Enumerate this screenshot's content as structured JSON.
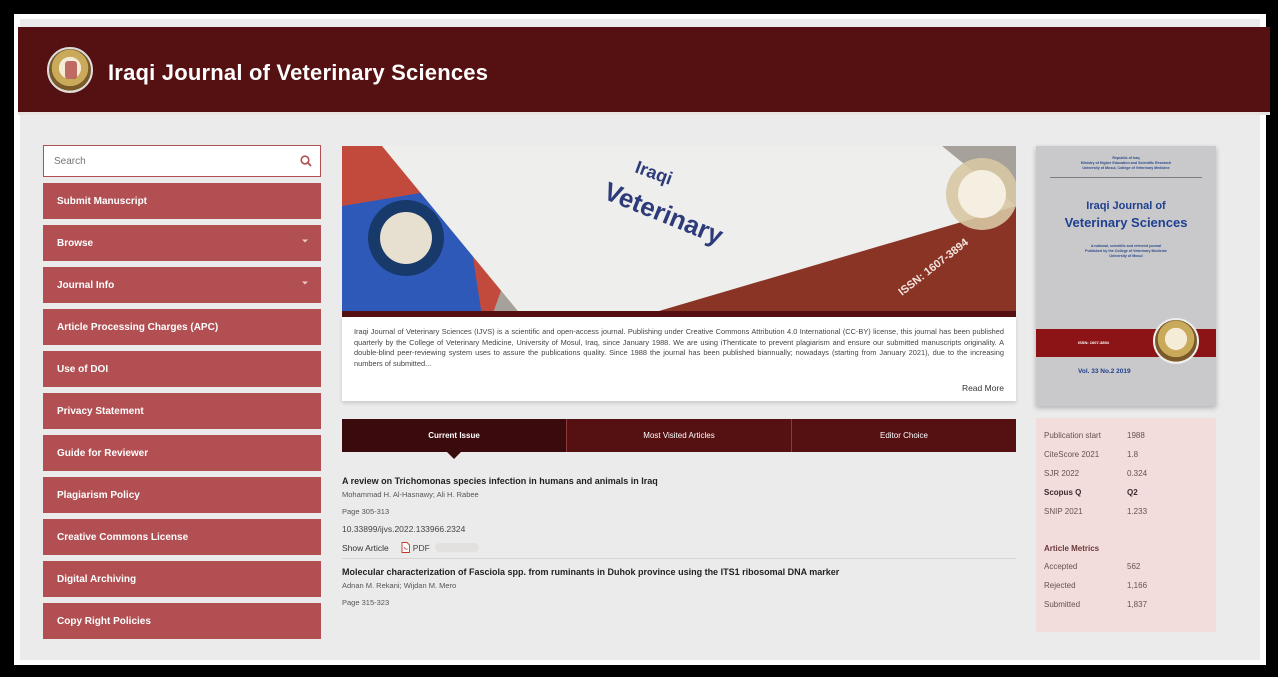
{
  "header": {
    "title": "Iraqi Journal of Veterinary Sciences"
  },
  "search": {
    "placeholder": "Search"
  },
  "sidebar": {
    "items": [
      {
        "label": "Submit Manuscript",
        "has_caret": false
      },
      {
        "label": "Browse",
        "has_caret": true
      },
      {
        "label": "Journal Info",
        "has_caret": true
      },
      {
        "label": "Article Processing Charges (APC)",
        "has_caret": false
      },
      {
        "label": "Use of DOI",
        "has_caret": false
      },
      {
        "label": "Privacy Statement",
        "has_caret": false
      },
      {
        "label": "Guide for Reviewer",
        "has_caret": false
      },
      {
        "label": "Plagiarism Policy",
        "has_caret": false
      },
      {
        "label": "Creative Commons License",
        "has_caret": false
      },
      {
        "label": "Digital Archiving",
        "has_caret": false
      },
      {
        "label": "Copy Right Policies",
        "has_caret": false
      }
    ]
  },
  "hero": {
    "cover_word1": "Iraqi",
    "cover_word2": "Veterinary",
    "issn": "ISSN: 1607-3894"
  },
  "about": {
    "text": "Iraqi Journal of Veterinary Sciences (IJVS) is a scientific and open-access journal. Publishing under Creative Commons Attribution 4.0 International (CC-BY) license, this journal has been published quarterly by the College of Veterinary Medicine, University of Mosul, Iraq, since January 1988. We are using iThenticate to prevent plagiarism and ensure our submitted manuscripts originality. A double-blind peer-reviewing system uses to assure the publications quality. Since 1988 the journal has been published biannually; nowadays (starting from January 2021), due to the increasing numbers of submitted...",
    "read_more": "Read More"
  },
  "tabs": [
    {
      "label": "Current Issue",
      "active": true
    },
    {
      "label": "Most Visited Articles",
      "active": false
    },
    {
      "label": "Editor Choice",
      "active": false
    }
  ],
  "articles": [
    {
      "title": "A review on Trichomonas species infection in humans and animals in Iraq",
      "authors": "Mohammad H. Al-Hasnawy; Ali H. Rabee",
      "pages": "Page 305-313",
      "doi": "10.33899/ijvs.2022.133966.2324",
      "show_article": "Show Article",
      "pdf_label": "PDF",
      "pdf_size": "763.77 K"
    },
    {
      "title": "Molecular characterization of Fasciola spp. from ruminants in Duhok province using the ITS1 ribosomal DNA marker",
      "authors": "Adnan M. Rekani; Wijdan M. Mero",
      "pages": "Page 315-323"
    }
  ],
  "cover": {
    "top_lines": [
      "Republic of Iraq",
      "Ministry of Higher Education and Scientific Research",
      "University of Mosul, College of Veterinary Medicine"
    ],
    "title_line1": "Iraqi Journal of",
    "title_line2": "Veterinary Sciences",
    "sub_lines": [
      "A national, scientific and refereed journal",
      "Published by the College of Veterinary Medicine",
      "University of Mosul"
    ],
    "issn": "ISSN: 1607-3894",
    "volume": "Vol. 33 No.2  2019"
  },
  "metrics": {
    "rows": [
      {
        "key": "Publication start",
        "value": "1988",
        "bold": false
      },
      {
        "key": "CiteScore 2021",
        "value": "1.8",
        "bold": false
      },
      {
        "key": "SJR 2022",
        "value": "0.324",
        "bold": false
      },
      {
        "key": "Scopus Q",
        "value": "Q2",
        "bold": true
      },
      {
        "key": "SNIP 2021",
        "value": "1.233",
        "bold": false
      }
    ],
    "article_metrics_title": "Article Metrics",
    "article_rows": [
      {
        "key": "Accepted",
        "value": "562"
      },
      {
        "key": "Rejected",
        "value": "1,166"
      },
      {
        "key": "Submitted",
        "value": "1,837"
      }
    ]
  },
  "colors": {
    "header_bg": "#551012",
    "nav_bg": "#b24f52",
    "tab_bg": "#551012",
    "metrics_bg": "#f2dcdc"
  }
}
